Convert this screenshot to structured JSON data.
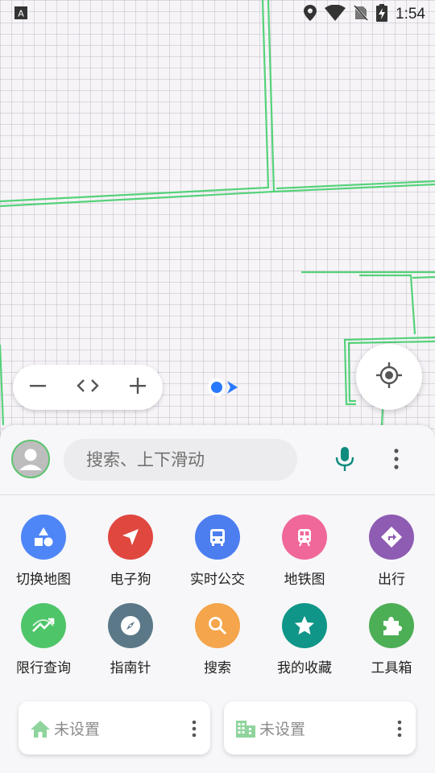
{
  "status_bar": {
    "time": "1:54",
    "icons": [
      "notification-a-icon",
      "location-icon",
      "wifi-icon",
      "no-sim-icon",
      "battery-charging-icon"
    ]
  },
  "map": {
    "road_color": "#55d27a",
    "my_location_color": "#2979ff"
  },
  "zoom_controls": {
    "icons": [
      "zoom-out-icon",
      "code-toggle-icon",
      "zoom-in-icon"
    ]
  },
  "search": {
    "placeholder": "搜索、上下滑动"
  },
  "shortcuts": [
    {
      "label": "切换地图",
      "icon": "shapes-icon",
      "color": "#4f86f7"
    },
    {
      "label": "电子狗",
      "icon": "navigation-arrow-icon",
      "color": "#e0473f"
    },
    {
      "label": "实时公交",
      "icon": "bus-icon",
      "color": "#4c7ef0"
    },
    {
      "label": "地铁图",
      "icon": "subway-icon",
      "color": "#f0679a"
    },
    {
      "label": "出行",
      "icon": "directions-icon",
      "color": "#8e5cb3"
    },
    {
      "label": "限行查询",
      "icon": "trending-icon",
      "color": "#4fc569"
    },
    {
      "label": "指南针",
      "icon": "compass-icon",
      "color": "#5b7888"
    },
    {
      "label": "搜索",
      "icon": "search-icon",
      "color": "#f5a54c"
    },
    {
      "label": "我的收藏",
      "icon": "star-icon",
      "color": "#0f9688"
    },
    {
      "label": "工具箱",
      "icon": "puzzle-icon",
      "color": "#4cae55"
    }
  ],
  "places": {
    "home": {
      "label": "未设置",
      "icon": "home-icon"
    },
    "work": {
      "label": "未设置",
      "icon": "building-icon"
    }
  }
}
